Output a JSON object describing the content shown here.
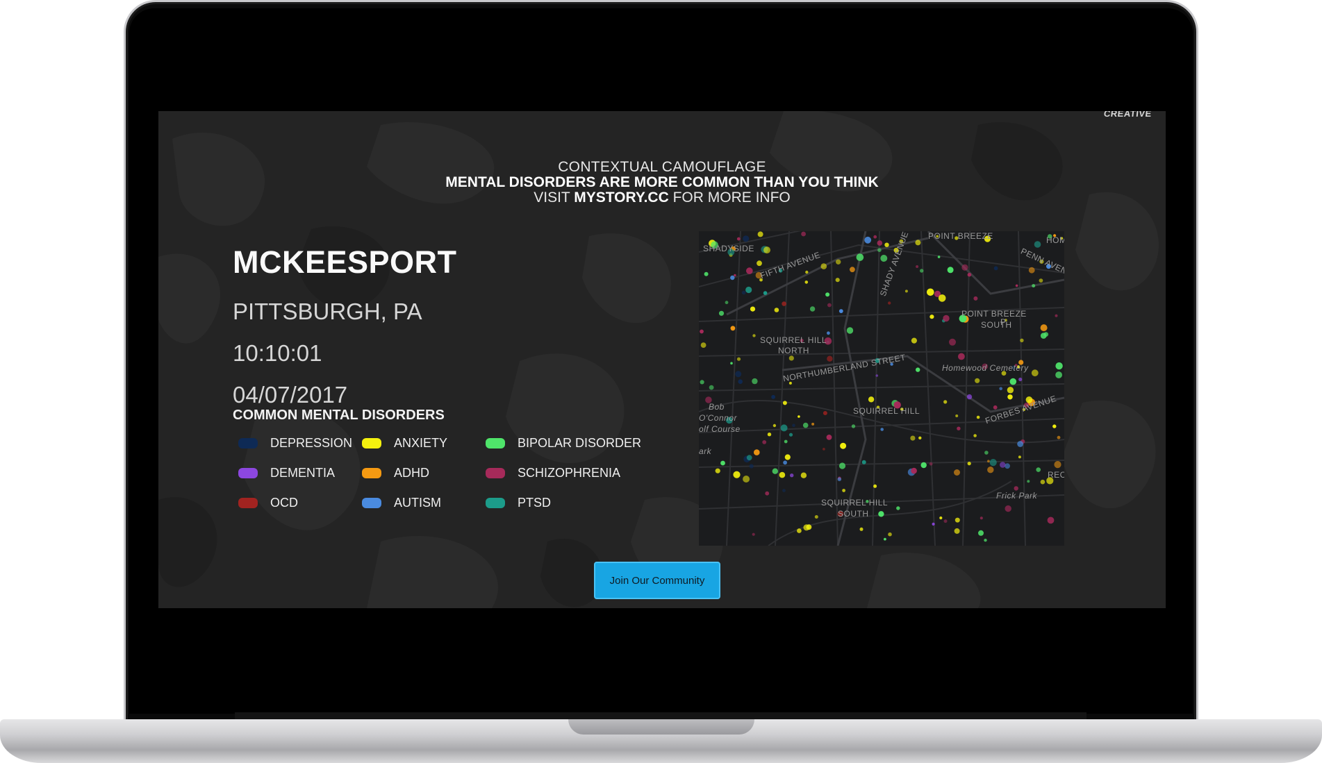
{
  "brand": "CREATIVE",
  "headline": {
    "line1": "CONTEXTUAL CAMOUFLAGE",
    "line2": "MENTAL DISORDERS ARE MORE COMMON THAN YOU THINK",
    "line3_prefix": "VISIT",
    "line3_link": "MYSTORY.CC",
    "line3_suffix": "FOR MORE INFO"
  },
  "location": {
    "city": "MCKEESPORT",
    "region": "PITTSBURGH, PA",
    "time": "10:10:01",
    "date": "04/07/2017"
  },
  "legend": {
    "title": "COMMON MENTAL DISORDERS",
    "items": [
      {
        "label": "DEPRESSION",
        "color": "#0e2a55"
      },
      {
        "label": "ANXIETY",
        "color": "#f4f10e"
      },
      {
        "label": "BIPOLAR DISORDER",
        "color": "#4fe46a"
      },
      {
        "label": "DEMENTIA",
        "color": "#8d47e0"
      },
      {
        "label": "ADHD",
        "color": "#f59a12"
      },
      {
        "label": "SCHIZOPHRENIA",
        "color": "#a62a5a"
      },
      {
        "label": "OCD",
        "color": "#a12320"
      },
      {
        "label": "AUTISM",
        "color": "#4a8be0"
      },
      {
        "label": "PTSD",
        "color": "#1c9c8a"
      }
    ]
  },
  "map": {
    "labels": [
      "SHADYSIDE",
      "POINT BREEZE",
      "HOM",
      "FIFTH AVENUE",
      "SHADY AVENUE",
      "PENN AVENUE",
      "POINT BREEZE",
      "SOUTH",
      "SQUIRREL HILL",
      "NORTH",
      "NORTHUMBERLAND STREET",
      "Homewood Cemetery",
      "SQUIRREL HILL",
      "FORBES AVENUE",
      "Bob",
      "O'Connor",
      "olf Course",
      "ark",
      "REC",
      "Frick Park",
      "SQUIRREL HILL",
      "SOUTH",
      "P"
    ]
  },
  "cta": {
    "label": "Join Our Community"
  }
}
